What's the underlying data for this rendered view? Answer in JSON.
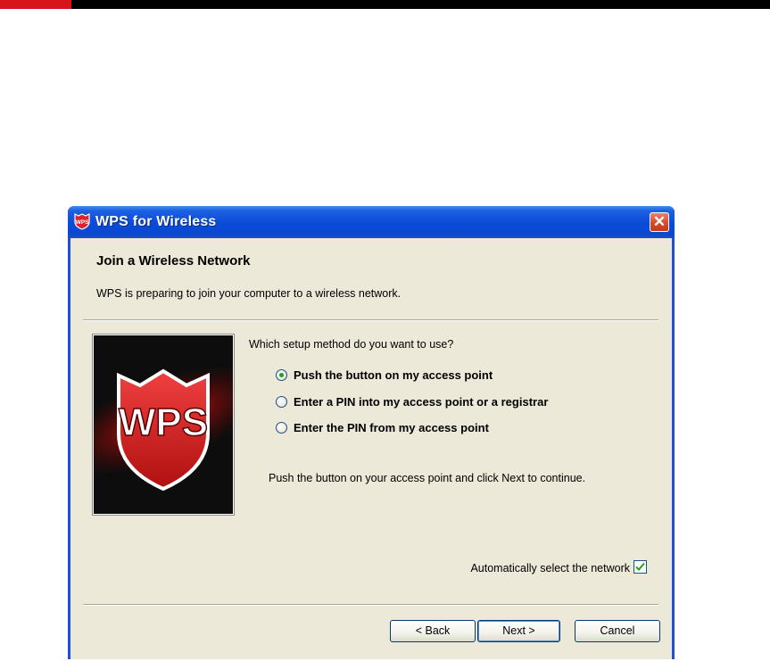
{
  "window": {
    "title": "WPS for Wireless",
    "close_glyph": "✕"
  },
  "header": {
    "title": "Join a Wireless Network",
    "subtitle": "WPS is preparing to join your computer to a wireless network."
  },
  "image": {
    "text": "WPS"
  },
  "setup": {
    "question": "Which setup method do you want to use?",
    "options": [
      {
        "label": "Push the button on my access point",
        "selected": true
      },
      {
        "label": "Enter a PIN into my access point or a registrar",
        "selected": false
      },
      {
        "label": "Enter the PIN from my access point",
        "selected": false
      }
    ],
    "hint": "Push the button on your access point and click Next to continue."
  },
  "auto_select": {
    "label": "Automatically select the network",
    "checked": true
  },
  "buttons": {
    "back": "< Back",
    "next": "Next >",
    "cancel": "Cancel"
  },
  "colors": {
    "title_bar": "#0a4bd8",
    "client_bg": "#ece9d8",
    "close_button": "#d6462a",
    "brand_red": "#d7141c"
  }
}
